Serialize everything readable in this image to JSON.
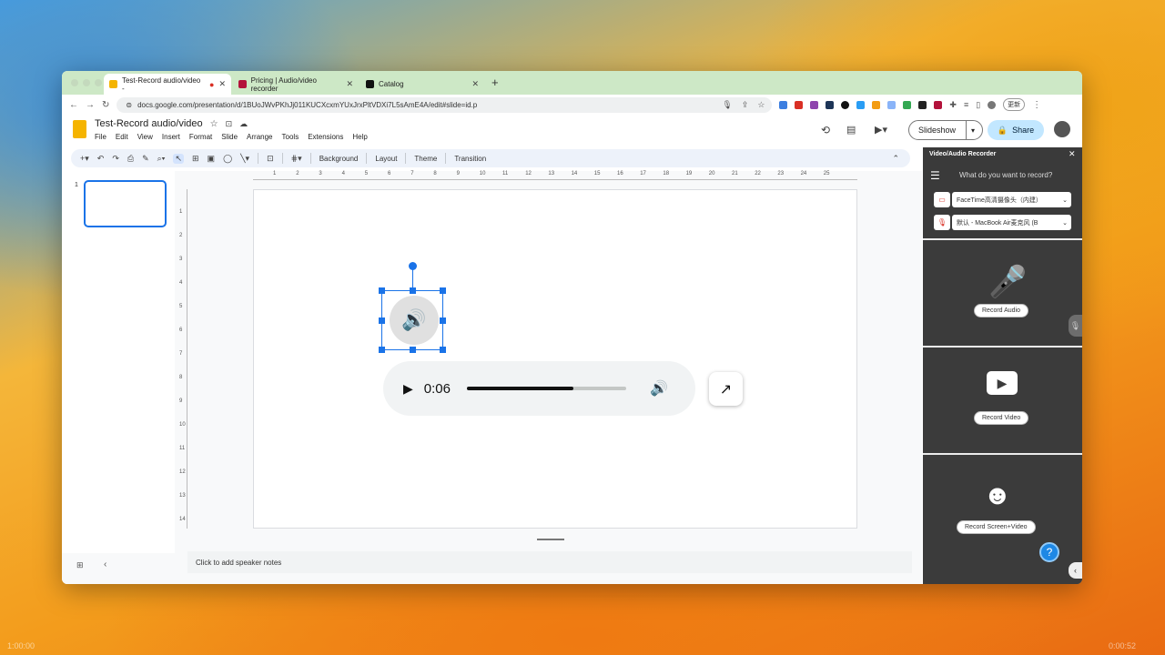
{
  "browser": {
    "tabs": [
      {
        "title": "Test-Record audio/video -",
        "active": true
      },
      {
        "title": "Pricing | Audio/video recorder",
        "active": false
      },
      {
        "title": "Catalog",
        "active": false
      }
    ],
    "new_tab": "+",
    "close": "✕",
    "url": "docs.google.com/presentation/d/1BUoJWvPKhJj011KUCXcxmYUxJrxPltVDXi7L5sAmE4A/edit#slide=id.p",
    "update_label": "更新"
  },
  "doc": {
    "title": "Test-Record audio/video",
    "menu": [
      "File",
      "Edit",
      "View",
      "Insert",
      "Format",
      "Slide",
      "Arrange",
      "Tools",
      "Extensions",
      "Help"
    ],
    "slideshow_label": "Slideshow",
    "share_label": "Share"
  },
  "toolbar": {
    "buttons": [
      "Background",
      "Layout",
      "Theme",
      "Transition"
    ]
  },
  "ruler": {
    "ticks": [
      "1",
      "2",
      "3",
      "4",
      "5",
      "6",
      "7",
      "8",
      "9",
      "10",
      "11",
      "12",
      "13",
      "14",
      "15",
      "16",
      "17",
      "18",
      "19",
      "20",
      "21",
      "22",
      "23",
      "24",
      "25"
    ],
    "vticks": [
      "1",
      "2",
      "3",
      "4",
      "5",
      "6",
      "7",
      "8",
      "9",
      "10",
      "11",
      "12",
      "13",
      "14"
    ]
  },
  "slides": {
    "thumb_number": "1"
  },
  "player": {
    "time": "0:06",
    "progress": 0.67
  },
  "notes": {
    "placeholder": "Click to add speaker notes"
  },
  "recorder": {
    "title": "Video/Audio Recorder",
    "prompt": "What do you want to record?",
    "camera": "FaceTime高清摄像头（内建）",
    "mic": "默认 - MacBook Air麦克风 (B",
    "record_audio": "Record Audio",
    "record_video": "Record Video",
    "record_screen": "Record Screen+Video",
    "help": "?"
  },
  "video_time": {
    "left": "1:00:00",
    "right": "0:00:52"
  },
  "colors": {
    "accent": "#1a73e8",
    "tabbar": "#cde8c6",
    "panel": "#3a3a3a"
  }
}
